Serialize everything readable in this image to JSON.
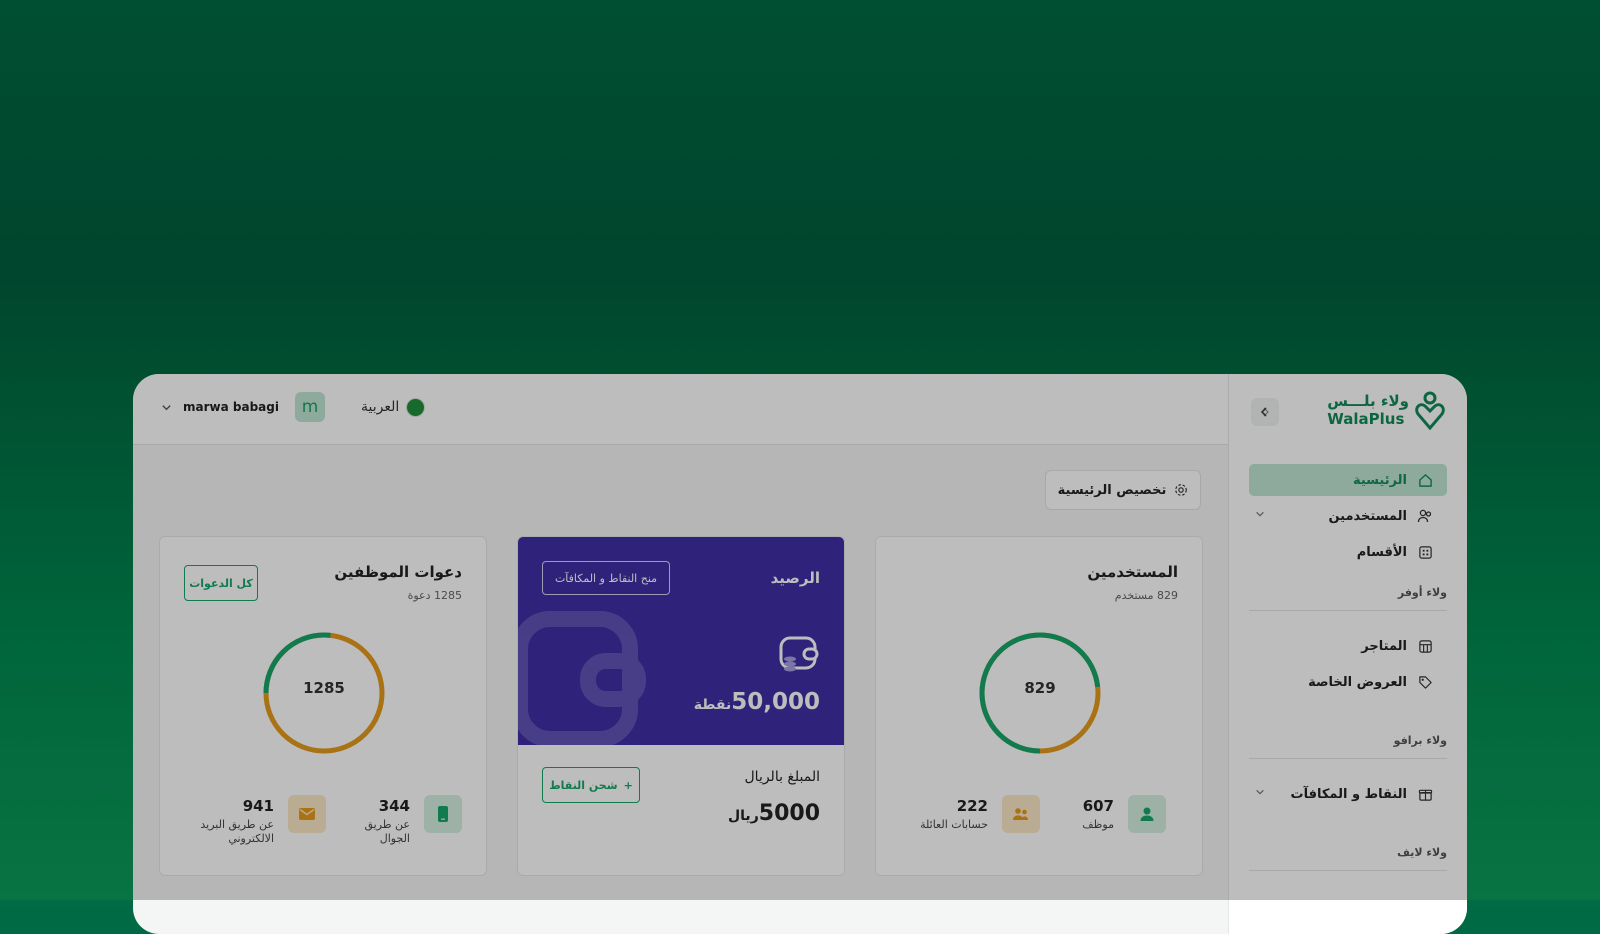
{
  "topbar": {
    "username": "marwa babagi",
    "avatar_letter": "m",
    "language": "العربية"
  },
  "main": {
    "customize_label": "تخصيص الرئيسية"
  },
  "users_card": {
    "title": "المستخدمين",
    "subtitle": "829 مستخدم",
    "total": "829",
    "stats": [
      {
        "value": "607",
        "label": "موظف"
      },
      {
        "value": "222",
        "label": "حسابات العائلة"
      }
    ],
    "split": [
      607,
      222
    ]
  },
  "balance_card": {
    "title": "الرصيد",
    "grant_button": "منح النقاط و المكافآت",
    "points_value": "50,000",
    "points_unit": "نقطة",
    "amount_title": "المبلغ بالريال",
    "amount_value": "5000",
    "amount_unit": "ريال",
    "recharge_button": "شحن النقاط"
  },
  "invites_card": {
    "title": "دعوات الموظفين",
    "subtitle": "1285 دعوة",
    "all_button": "كل الدعوات",
    "total": "1285",
    "stats": [
      {
        "value": "344",
        "label_line1": "عن طريق",
        "label_line2": "الجوال"
      },
      {
        "value": "941",
        "label_line1": "عن طريق البريد",
        "label_line2": "الالكتروني"
      }
    ],
    "split": [
      344,
      941
    ]
  },
  "sidebar": {
    "logo_ar": "ولاء بلـــس",
    "logo_en": "WalaPlus",
    "items": [
      {
        "label": "الرئيسية"
      },
      {
        "label": "المستخدمين"
      },
      {
        "label": "الأقسام"
      }
    ],
    "section_awfar": "ولاء أوفر",
    "awfar_items": [
      {
        "label": "المتاجر"
      },
      {
        "label": "العروض الخاصة"
      }
    ],
    "section_bravo": "ولاء برافو",
    "bravo_items": [
      {
        "label": "النقاط و المكافآت"
      }
    ],
    "section_life": "ولاء لايف"
  },
  "colors": {
    "accent_green": "#17A66B",
    "orange": "#E49A1B",
    "purple": "#3E2EA6"
  }
}
